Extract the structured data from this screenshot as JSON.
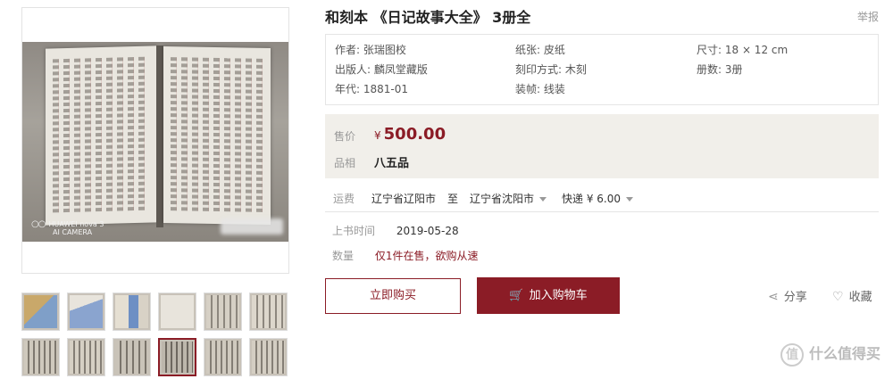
{
  "product": {
    "title": "和刻本 《日记故事大全》 3册全",
    "report_link": "举报"
  },
  "attributes": [
    {
      "label": "作者: 张瑞图校"
    },
    {
      "label": "纸张: 皮纸"
    },
    {
      "label": "尺寸: 18 × 12 cm"
    },
    {
      "label": "出版人: 麟凤堂藏版"
    },
    {
      "label": "刻印方式: 木刻"
    },
    {
      "label": "册数: 3册"
    },
    {
      "label": "年代: 1881-01"
    },
    {
      "label": "装帧: 线装"
    }
  ],
  "price": {
    "label": "售价",
    "currency": "¥",
    "value": "500.00",
    "condition_label": "品相",
    "condition": "八五品"
  },
  "shipping": {
    "label": "运费",
    "from": "辽宁省辽阳市",
    "to_word": "至",
    "to": "辽宁省沈阳市",
    "method": "快递 ¥ 6.00"
  },
  "listed": {
    "label": "上书时间",
    "date": "2019-05-28"
  },
  "quantity": {
    "label": "数量",
    "text": "仅1件在售，欲购从速"
  },
  "buttons": {
    "buy_now": "立即购买",
    "add_cart": "加入购物车",
    "share": "分享",
    "favorite": "收藏"
  },
  "image_watermark": {
    "line1": "HUAWEI nova 3",
    "line2": "AI CAMERA"
  },
  "brand": "什么值得买",
  "colors": {
    "accent": "#8b1c26",
    "price_bg": "#f1efea"
  }
}
